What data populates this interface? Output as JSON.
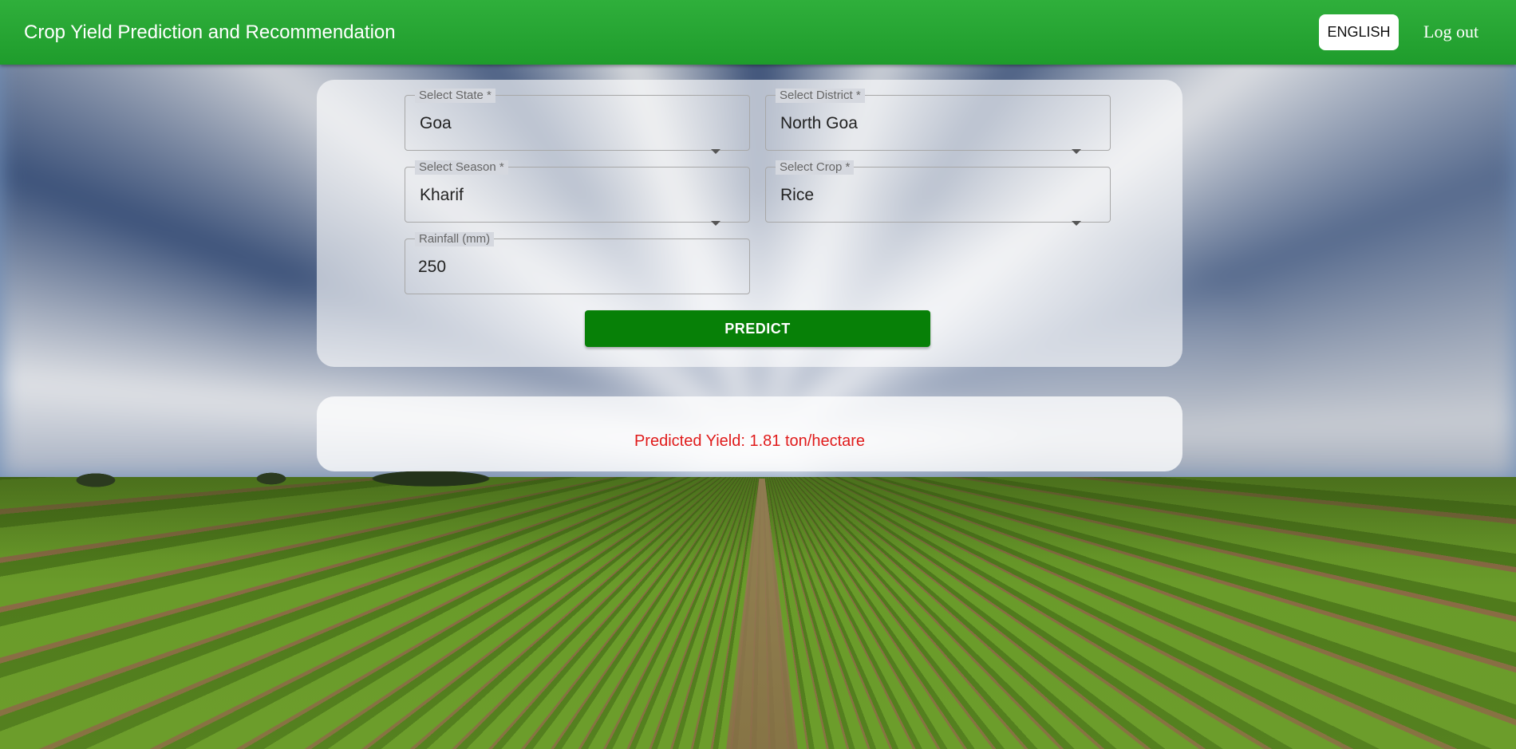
{
  "header": {
    "title": "Crop Yield Prediction and Recommendation",
    "language_button": "ENGLISH",
    "logout_label": "Log out"
  },
  "form": {
    "state": {
      "label": "Select State *",
      "value": "Goa",
      "icon": "chevron-down-icon"
    },
    "district": {
      "label": "Select District *",
      "value": "North Goa",
      "icon": "chevron-down-icon"
    },
    "season": {
      "label": "Select Season *",
      "value": "Kharif",
      "icon": "chevron-down-icon"
    },
    "crop": {
      "label": "Select Crop *",
      "value": "Rice",
      "icon": "chevron-down-icon"
    },
    "rainfall": {
      "label": "Rainfall (mm)",
      "value": "250"
    },
    "predict_label": "PREDICT"
  },
  "result": {
    "text": "Predicted Yield: 1.81 ton/hectare"
  },
  "colors": {
    "header_green": "#2aa836",
    "predict_button": "#078007",
    "result_text": "#e01b1b"
  }
}
